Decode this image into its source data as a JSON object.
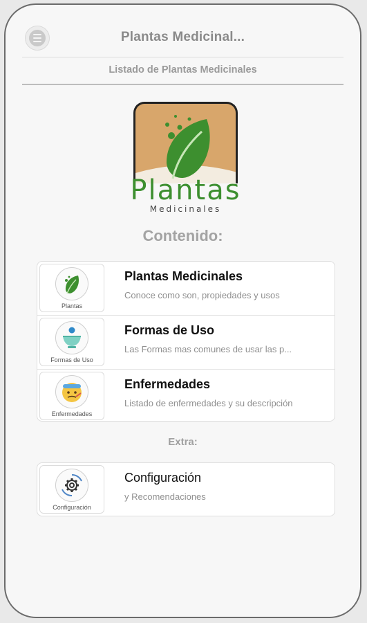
{
  "header": {
    "menu_icon": "menu-icon",
    "title": "Plantas Medicinal...",
    "subtitle": "Listado de Plantas Medicinales"
  },
  "logo": {
    "line1": "Plantas",
    "line2": "Medicinales",
    "colors": {
      "background": "#d8a66b",
      "leaf": "#3d8f2f",
      "ground": "#f3ece0"
    }
  },
  "content": {
    "title": "Contenido:",
    "items": [
      {
        "icon": "leaf-icon",
        "thumb_label": "Plantas",
        "title": "Plantas Medicinales",
        "desc": "Conoce como son, propiedades y usos"
      },
      {
        "icon": "mortar-bowl-icon",
        "thumb_label": "Formas de Uso",
        "title": "Formas de Uso",
        "desc": "Las Formas mas comunes de usar las p..."
      },
      {
        "icon": "sick-face-icon",
        "thumb_label": "Enfermedades",
        "title": "Enfermedades",
        "desc": "Listado de enfermedades y su descripción"
      }
    ]
  },
  "extra": {
    "title": "Extra:",
    "items": [
      {
        "icon": "gear-icon",
        "thumb_label": "Configuración",
        "title": "Configuración",
        "desc": "y Recomendaciones"
      }
    ]
  }
}
